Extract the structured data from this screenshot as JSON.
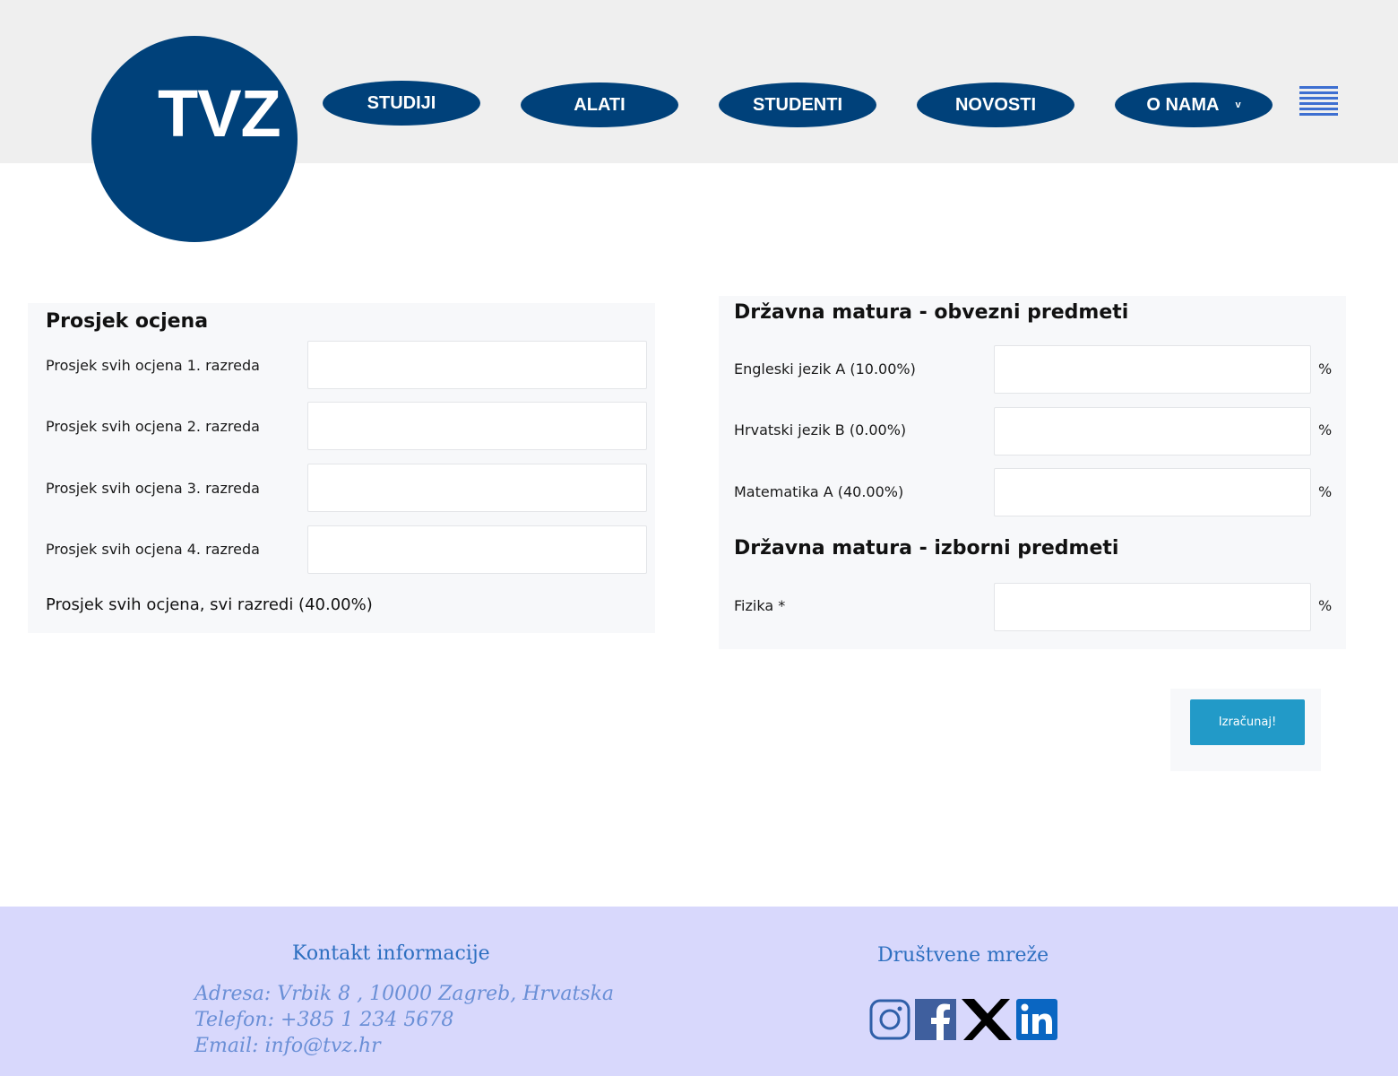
{
  "logo": {
    "text": "TVZ"
  },
  "nav": {
    "items": [
      "STUDIJI",
      "ALATI",
      "STUDENTI",
      "NOVOSTI",
      "O NAMA"
    ],
    "dropdown_indicator": "v"
  },
  "left_panel": {
    "title": "Prosjek ocjena",
    "rows": [
      {
        "label": "Prosjek svih ocjena 1. razreda",
        "value": ""
      },
      {
        "label": "Prosjek svih ocjena 2. razreda",
        "value": ""
      },
      {
        "label": "Prosjek svih ocjena 3. razreda",
        "value": ""
      },
      {
        "label": "Prosjek svih ocjena 4. razreda",
        "value": ""
      }
    ],
    "summary": "Prosjek svih ocjena, svi razredi (40.00%)"
  },
  "right_panel": {
    "mandatory_title": "Državna matura - obvezni predmeti",
    "mandatory_rows": [
      {
        "label": "Engleski jezik A (10.00%)",
        "value": "",
        "unit": "%"
      },
      {
        "label": "Hrvatski jezik B (0.00%)",
        "value": "",
        "unit": "%"
      },
      {
        "label": "Matematika A (40.00%)",
        "value": "",
        "unit": "%"
      }
    ],
    "elective_title": "Državna matura - izborni predmeti",
    "elective_rows": [
      {
        "label": "Fizika *",
        "value": "",
        "unit": "%"
      }
    ]
  },
  "calculate_button": {
    "label": "Izračunaj!"
  },
  "footer": {
    "contact_heading": "Kontakt informacije",
    "address": "Adresa: Vrbik 8 , 10000 Zagreb, Hrvatska",
    "phone": "Telefon: +385 1 234 5678",
    "email": "Email: info@tvz.hr",
    "social_heading": "Društvene mreže",
    "social_icons": [
      "instagram-icon",
      "facebook-icon",
      "x-icon",
      "linkedin-icon"
    ]
  },
  "colors": {
    "brand_blue": "#00417a",
    "button_blue": "#229ac8",
    "footer_bg": "#d8d8fc",
    "footer_heading": "#2d6fc0"
  }
}
